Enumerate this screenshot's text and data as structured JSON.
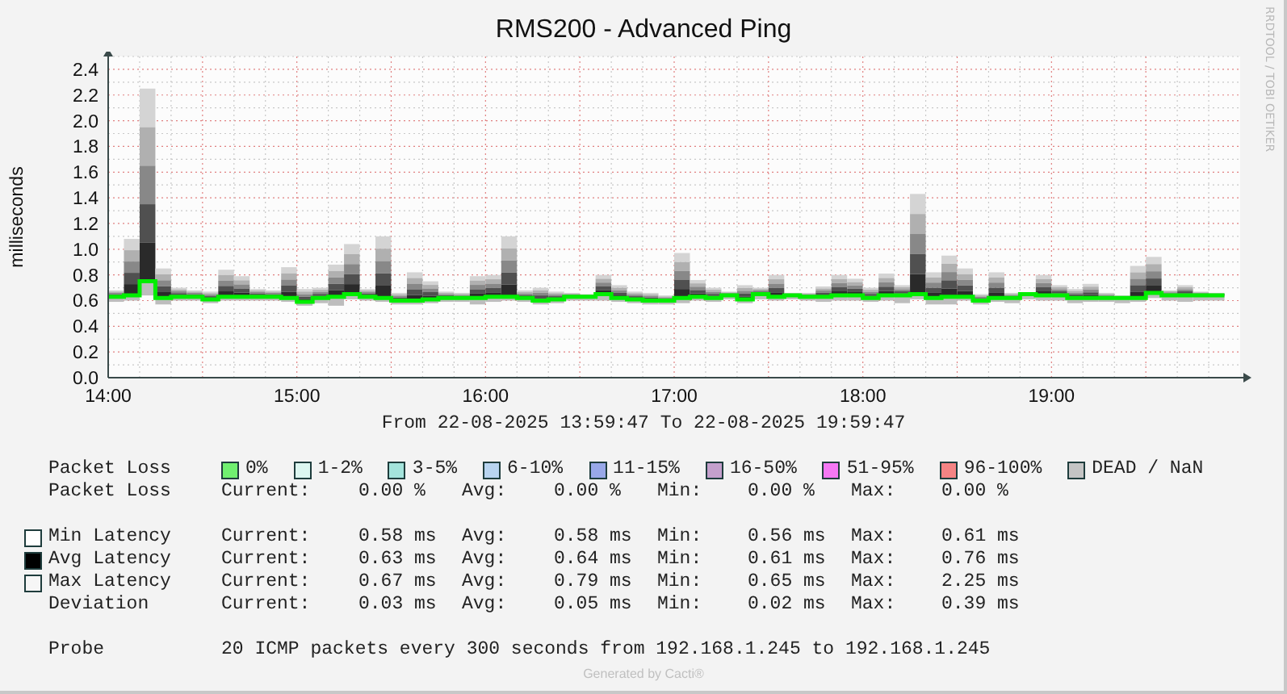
{
  "title": "RMS200 - Advanced Ping",
  "side_credit": "RRDTOOL / TOBI OETIKER",
  "chart": {
    "y_axis_label": "milliseconds",
    "y_tick_labels": [
      "2.4",
      "2.2",
      "2.0",
      "1.8",
      "1.6",
      "1.4",
      "1.2",
      "1.0",
      "0.8",
      "0.6",
      "0.4",
      "0.2",
      "0.0"
    ],
    "x_tick_labels": [
      "14:00",
      "15:00",
      "16:00",
      "17:00",
      "18:00",
      "19:00"
    ]
  },
  "time_range": "From 22-08-2025 13:59:47 To 22-08-2025 19:59:47",
  "loss_legend": {
    "label": "Packet Loss",
    "items": [
      {
        "label": "0%",
        "color": "#70f070"
      },
      {
        "label": "1-2%",
        "color": "#dcf6f0"
      },
      {
        "label": "3-5%",
        "color": "#a4e4dc"
      },
      {
        "label": "6-10%",
        "color": "#b8d4f0"
      },
      {
        "label": "11-15%",
        "color": "#98a8e8"
      },
      {
        "label": "16-50%",
        "color": "#c4a0cc"
      },
      {
        "label": "51-95%",
        "color": "#f478f4"
      },
      {
        "label": "96-100%",
        "color": "#f48484"
      },
      {
        "label": "DEAD / NaN",
        "color": "#c4c4c4"
      }
    ]
  },
  "stats": [
    {
      "label": "Packet Loss",
      "cells": [
        {
          "label": "Current:",
          "value": "0.00 %"
        },
        {
          "label": "Avg:",
          "value": "0.00 %"
        },
        {
          "label": "Min:",
          "value": "0.00 %"
        },
        {
          "label": "Max:",
          "value": "0.00 %"
        }
      ]
    },
    {
      "label": "Min Latency",
      "color": "#ffffff",
      "cells": [
        {
          "label": "Current:",
          "value": "0.58 ms"
        },
        {
          "label": "Avg:",
          "value": "0.58 ms"
        },
        {
          "label": "Min:",
          "value": "0.56 ms"
        },
        {
          "label": "Max:",
          "value": "0.61 ms"
        }
      ]
    },
    {
      "label": "Avg Latency",
      "color": "#000000",
      "cells": [
        {
          "label": "Current:",
          "value": "0.63 ms"
        },
        {
          "label": "Avg:",
          "value": "0.64 ms"
        },
        {
          "label": "Min:",
          "value": "0.61 ms"
        },
        {
          "label": "Max:",
          "value": "0.76 ms"
        }
      ]
    },
    {
      "label": "Max Latency",
      "color": "#f6f6f6",
      "cells": [
        {
          "label": "Current:",
          "value": "0.67 ms"
        },
        {
          "label": "Avg:",
          "value": "0.79 ms"
        },
        {
          "label": "Min:",
          "value": "0.65 ms"
        },
        {
          "label": "Max:",
          "value": "2.25 ms"
        }
      ]
    },
    {
      "label": "Deviation",
      "cells": [
        {
          "label": "Current:",
          "value": "0.03 ms"
        },
        {
          "label": "Avg:",
          "value": "0.05 ms"
        },
        {
          "label": "Min:",
          "value": "0.02 ms"
        },
        {
          "label": "Max:",
          "value": "0.39 ms"
        }
      ]
    }
  ],
  "probe": {
    "label": "Probe",
    "text": "20 ICMP packets every 300 seconds from 192.168.1.245 to 192.168.1.245"
  },
  "footer": "Generated by Cacti®"
}
